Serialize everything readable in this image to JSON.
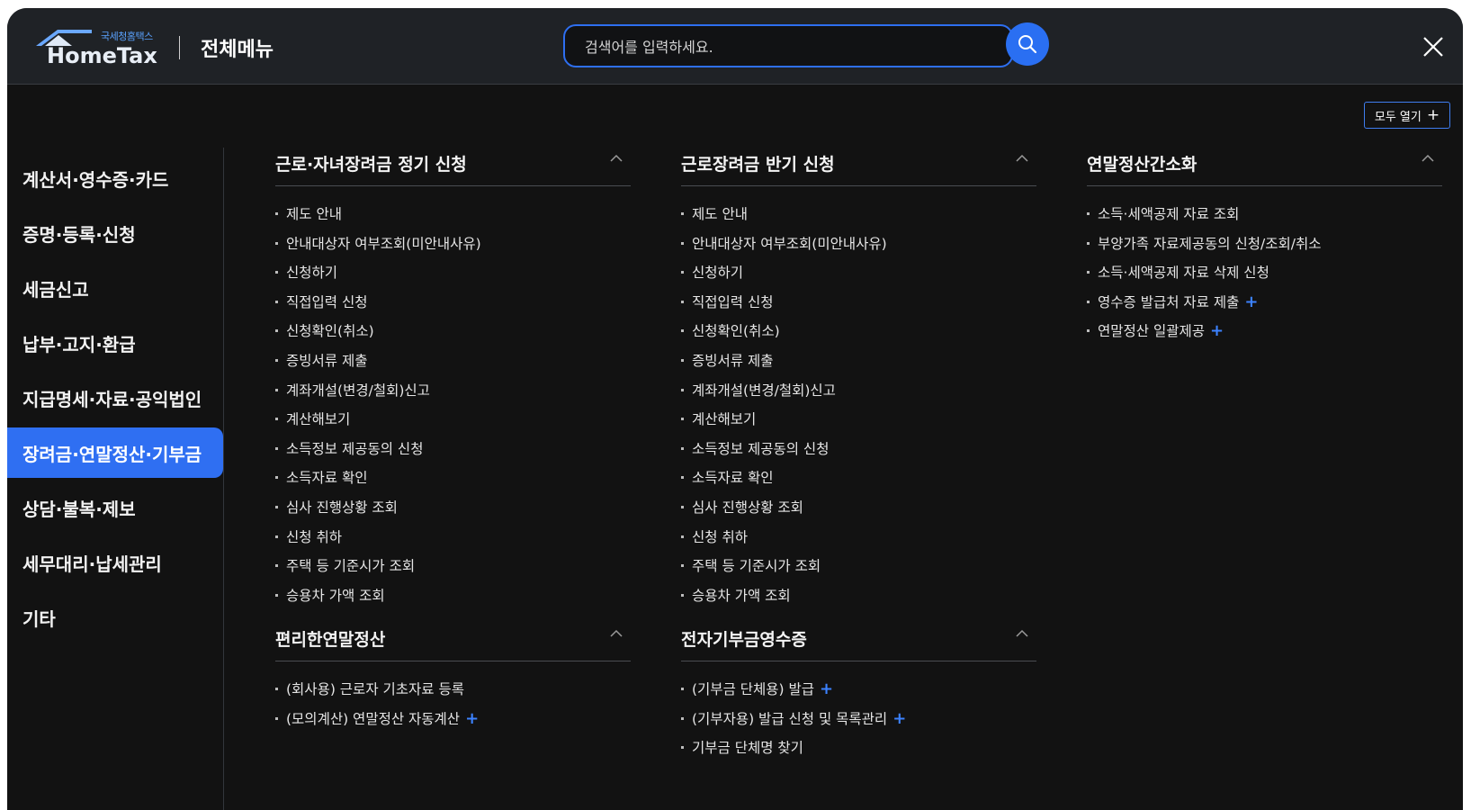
{
  "header": {
    "logo_small": "국세청홈택스",
    "logo_main": "HomeTax",
    "title": "전체메뉴",
    "search_placeholder": "검색어를 입력하세요.",
    "expand_all_label": "모두 열기"
  },
  "colors": {
    "accent": "#2f6ff2",
    "background": "#121212",
    "header": "#1f2226",
    "plus": "#3c82ff"
  },
  "sidebar": {
    "items": [
      {
        "label": "계산서·영수증·카드"
      },
      {
        "label": "증명·등록·신청"
      },
      {
        "label": "세금신고"
      },
      {
        "label": "납부·고지·환급"
      },
      {
        "label": "지급명세·자료·공익법인"
      },
      {
        "label": "장려금·연말정산·기부금",
        "active": true
      },
      {
        "label": "상담·불복·제보"
      },
      {
        "label": "세무대리·납세관리"
      },
      {
        "label": "기타"
      }
    ]
  },
  "sections": [
    {
      "title": "근로·자녀장려금 정기 신청",
      "items": [
        {
          "label": "제도 안내"
        },
        {
          "label": "안내대상자 여부조회(미안내사유)"
        },
        {
          "label": "신청하기"
        },
        {
          "label": "직접입력 신청"
        },
        {
          "label": "신청확인(취소)"
        },
        {
          "label": "증빙서류 제출"
        },
        {
          "label": "계좌개설(변경/철회)신고"
        },
        {
          "label": "계산해보기"
        },
        {
          "label": "소득정보 제공동의 신청"
        },
        {
          "label": "소득자료 확인"
        },
        {
          "label": "심사 진행상황 조회"
        },
        {
          "label": "신청 취하"
        },
        {
          "label": "주택 등 기준시가 조회"
        },
        {
          "label": "승용차 가액 조회"
        }
      ]
    },
    {
      "title": "근로장려금 반기 신청",
      "items": [
        {
          "label": "제도 안내"
        },
        {
          "label": "안내대상자 여부조회(미안내사유)"
        },
        {
          "label": "신청하기"
        },
        {
          "label": "직접입력 신청"
        },
        {
          "label": "신청확인(취소)"
        },
        {
          "label": "증빙서류 제출"
        },
        {
          "label": "계좌개설(변경/철회)신고"
        },
        {
          "label": "계산해보기"
        },
        {
          "label": "소득정보 제공동의 신청"
        },
        {
          "label": "소득자료 확인"
        },
        {
          "label": "심사 진행상황 조회"
        },
        {
          "label": "신청 취하"
        },
        {
          "label": "주택 등 기준시가 조회"
        },
        {
          "label": "승용차 가액 조회"
        }
      ]
    },
    {
      "title": "연말정산간소화",
      "items": [
        {
          "label": "소득·세액공제 자료 조회"
        },
        {
          "label": "부양가족 자료제공동의 신청/조회/취소"
        },
        {
          "label": "소득·세액공제 자료 삭제 신청"
        },
        {
          "label": "영수증 발급처 자료 제출",
          "expandable": true
        },
        {
          "label": "연말정산 일괄제공",
          "expandable": true
        }
      ]
    },
    {
      "title": "편리한연말정산",
      "items": [
        {
          "label": "(회사용) 근로자 기초자료 등록"
        },
        {
          "label": "(모의계산) 연말정산 자동계산",
          "expandable": true
        }
      ]
    },
    {
      "title": "전자기부금영수증",
      "items": [
        {
          "label": "(기부금 단체용) 발급",
          "expandable": true
        },
        {
          "label": "(기부자용) 발급 신청 및 목록관리",
          "expandable": true
        },
        {
          "label": "기부금 단체명 찾기"
        }
      ]
    }
  ]
}
